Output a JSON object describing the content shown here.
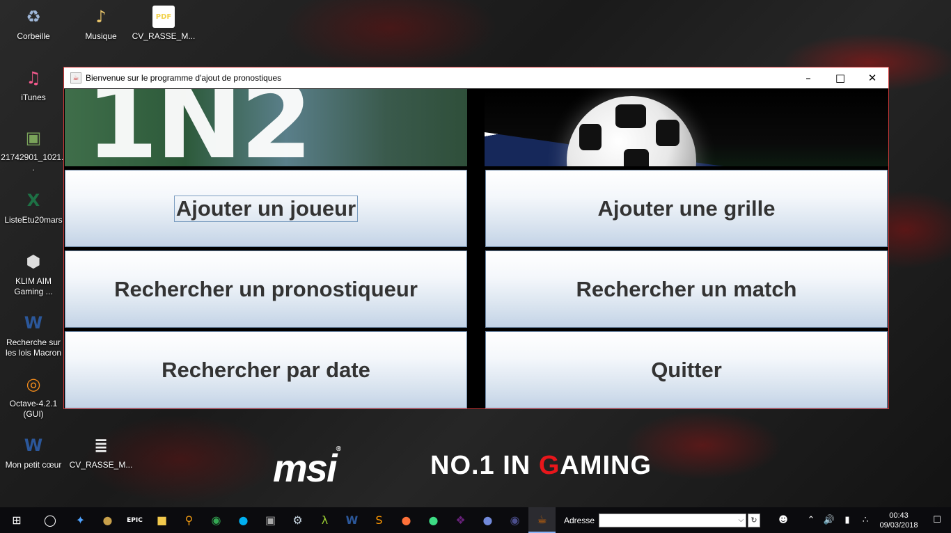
{
  "desktop": {
    "icons": [
      {
        "label": "Corbeille",
        "glyph": "♻",
        "color": "#9fb7d8"
      },
      {
        "label": "Musique",
        "glyph": "♪",
        "color": "#e8c46a"
      },
      {
        "label": "CV_RASSE_M...",
        "glyph": "PDF",
        "color": "#f2d24b"
      },
      {
        "label": "iTunes",
        "glyph": "♫",
        "color": "#f65a8e"
      },
      {
        "label": "21742901_1021...",
        "glyph": "▣",
        "color": "#7aa35a"
      },
      {
        "label": "ListeEtu20mars",
        "glyph": "X",
        "color": "#1e7145"
      },
      {
        "label": "KLIM AIM Gaming ...",
        "glyph": "⬢",
        "color": "#ddd"
      },
      {
        "label": "Recherche sur les lois Macron",
        "glyph": "W",
        "color": "#2b579a"
      },
      {
        "label": "Octave-4.2.1 (GUI)",
        "glyph": "◎",
        "color": "#f08a1c"
      },
      {
        "label": "Mon petit cœur",
        "glyph": "W",
        "color": "#2b579a"
      },
      {
        "label": "CV_RASSE_M...",
        "glyph": "≣",
        "color": "#eee"
      }
    ]
  },
  "window": {
    "title": "Bienvenue sur le programme d'ajout de pronostiques",
    "banner_text": "1N2",
    "buttons": {
      "add_player": "Ajouter un joueur",
      "add_grid": "Ajouter une grille",
      "search_forecaster": "Rechercher un pronostiqueur",
      "search_match": "Rechercher un match",
      "search_date": "Rechercher par date",
      "quit": "Quitter"
    }
  },
  "wallpaper": {
    "brand": "msi",
    "slogan_prefix": "NO.1 IN ",
    "slogan_g": "G",
    "slogan_suffix": "AMING"
  },
  "taskbar": {
    "address_label": "Adresse",
    "time": "00:43",
    "date": "09/03/2018"
  }
}
